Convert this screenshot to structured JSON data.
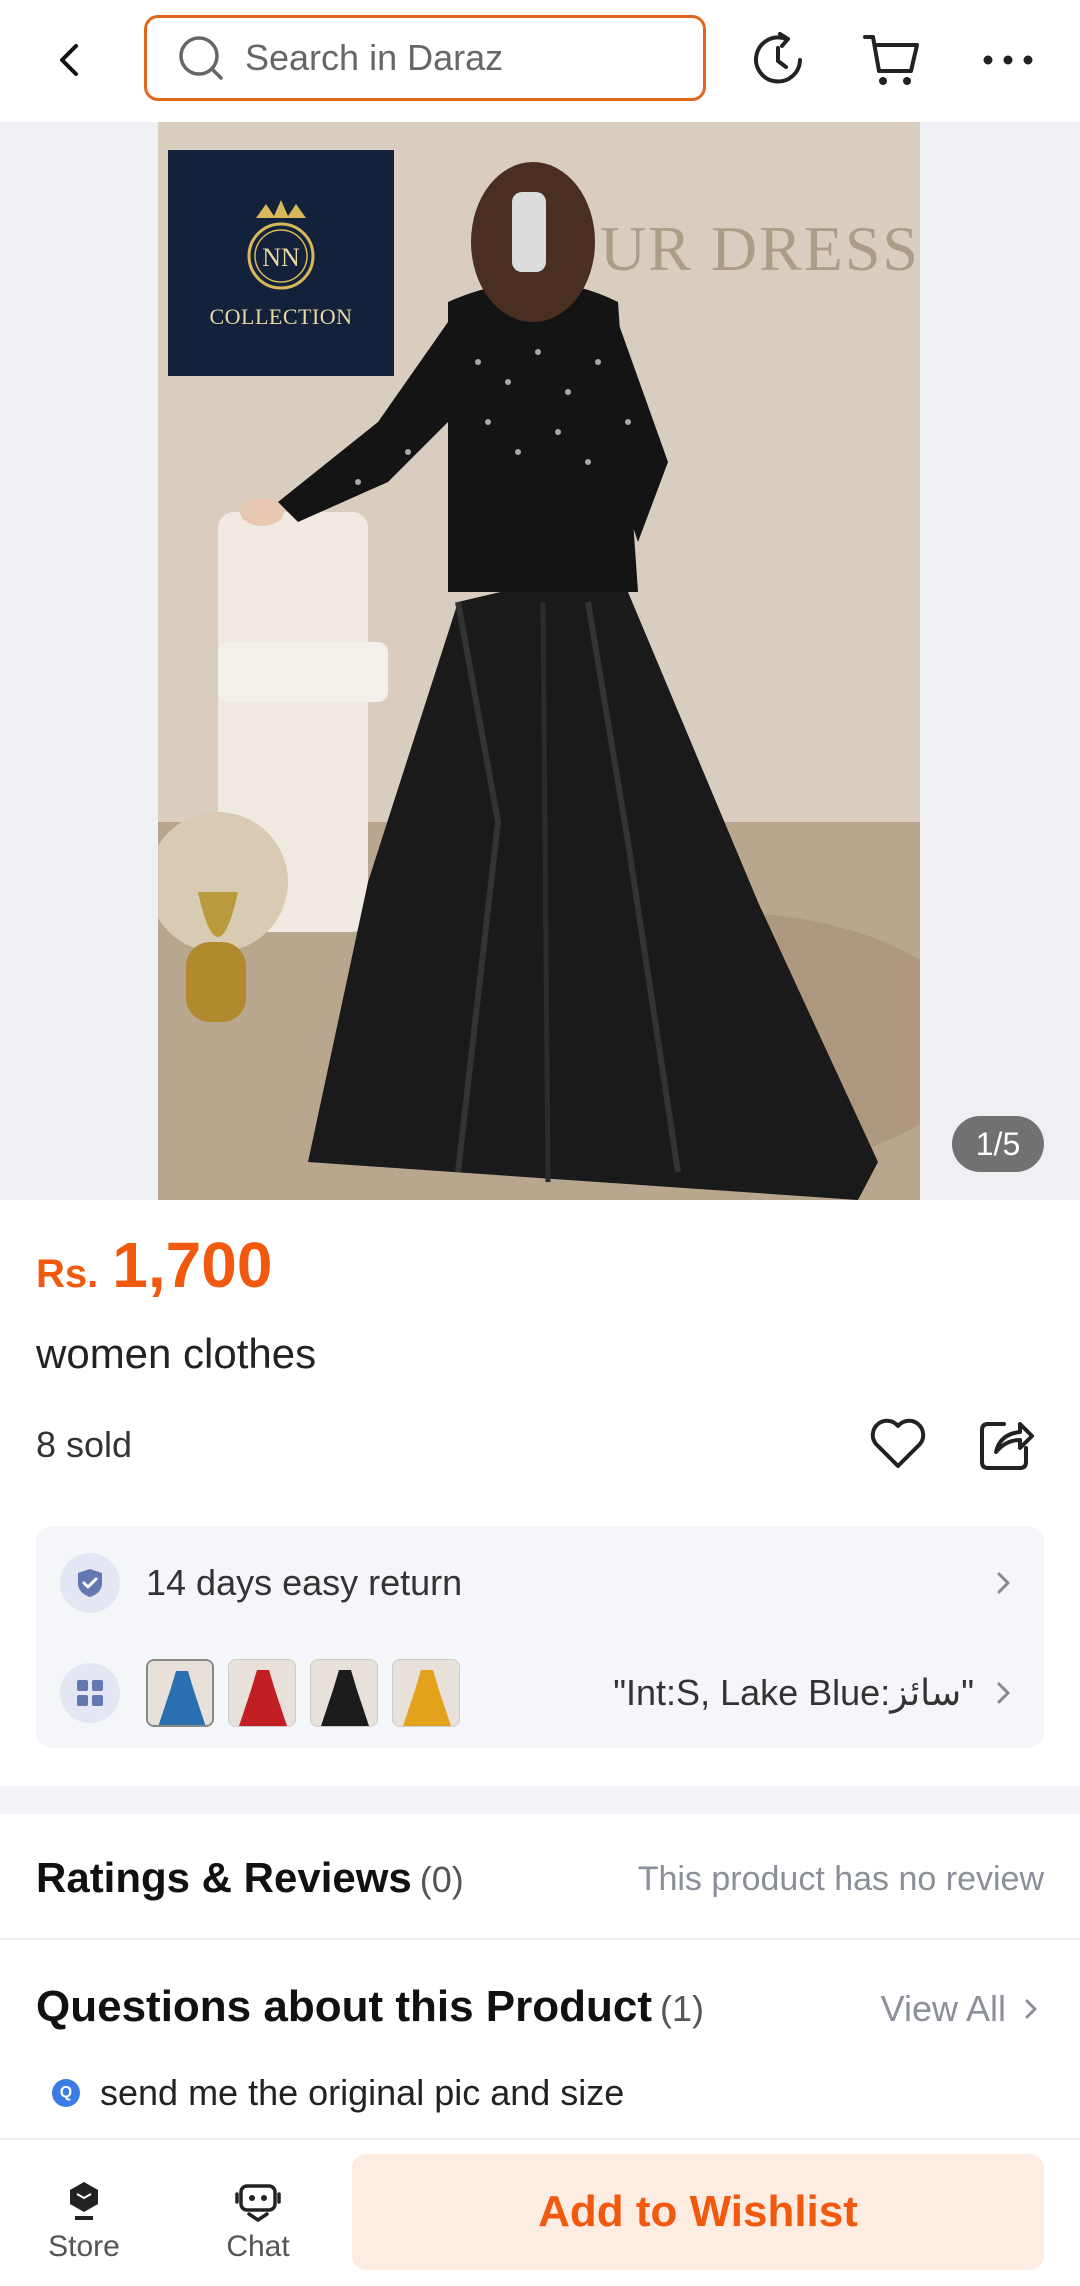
{
  "header": {
    "search_placeholder": "Search in Daraz"
  },
  "gallery": {
    "logo_text": "COLLECTION",
    "logo_monogram": "NN",
    "wall_text": "UR DRESS",
    "counter": "1/5"
  },
  "product": {
    "currency": "Rs.",
    "price": "1,700",
    "title": "women clothes",
    "sold": "8 sold"
  },
  "services": {
    "return_text": "14 days easy return",
    "variant_text": "\"Int:S, Lake Blue:سائز\"",
    "variant_colors": [
      "#2a6fb0",
      "#c11f24",
      "#1c1c1c",
      "#e2a21b"
    ]
  },
  "ratings": {
    "heading": "Ratings & Reviews",
    "count": "(0)",
    "note": "This product has no review"
  },
  "questions": {
    "heading": "Questions about this Product",
    "count": "(1)",
    "view_all": "View All",
    "badge": "Q",
    "first_question": "send me the original pic and size"
  },
  "bottom_bar": {
    "store_label": "Store",
    "chat_label": "Chat",
    "wishlist_label": "Add to Wishlist"
  },
  "colors": {
    "accent": "#f0590e",
    "search_border": "#e0661e"
  }
}
